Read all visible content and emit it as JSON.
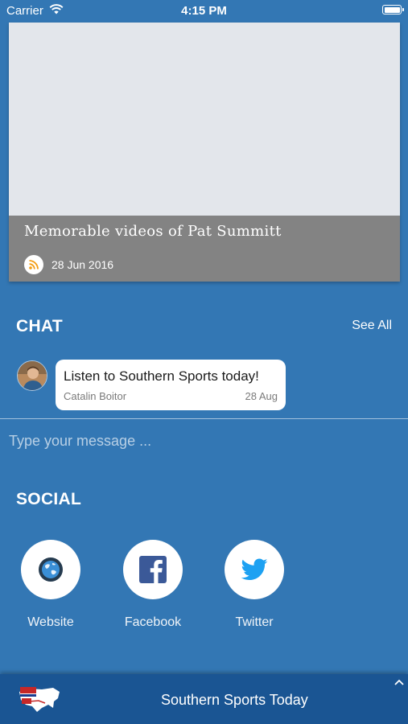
{
  "status_bar": {
    "carrier": "Carrier",
    "time": "4:15 PM"
  },
  "feed": {
    "title": "Memorable videos of Pat Summitt",
    "date": "28 Jun 2016",
    "icon": "rss-icon"
  },
  "chat": {
    "title": "CHAT",
    "see_all": "See All",
    "message": {
      "text": "Listen to Southern Sports today!",
      "author": "Catalin Boitor",
      "date": "28 Aug"
    },
    "input_placeholder": "Type your message ..."
  },
  "social": {
    "title": "SOCIAL",
    "items": [
      {
        "label": "Website",
        "icon": "globe-icon"
      },
      {
        "label": "Facebook",
        "icon": "facebook-icon"
      },
      {
        "label": "Twitter",
        "icon": "twitter-icon"
      }
    ]
  },
  "footer": {
    "title": "Southern Sports Today"
  },
  "colors": {
    "background": "#3377b4",
    "footer": "#1a5593",
    "feed_overlay": "#838383",
    "rss": "#f39c12",
    "twitter": "#1da1f2",
    "facebook": "#3b5998"
  }
}
